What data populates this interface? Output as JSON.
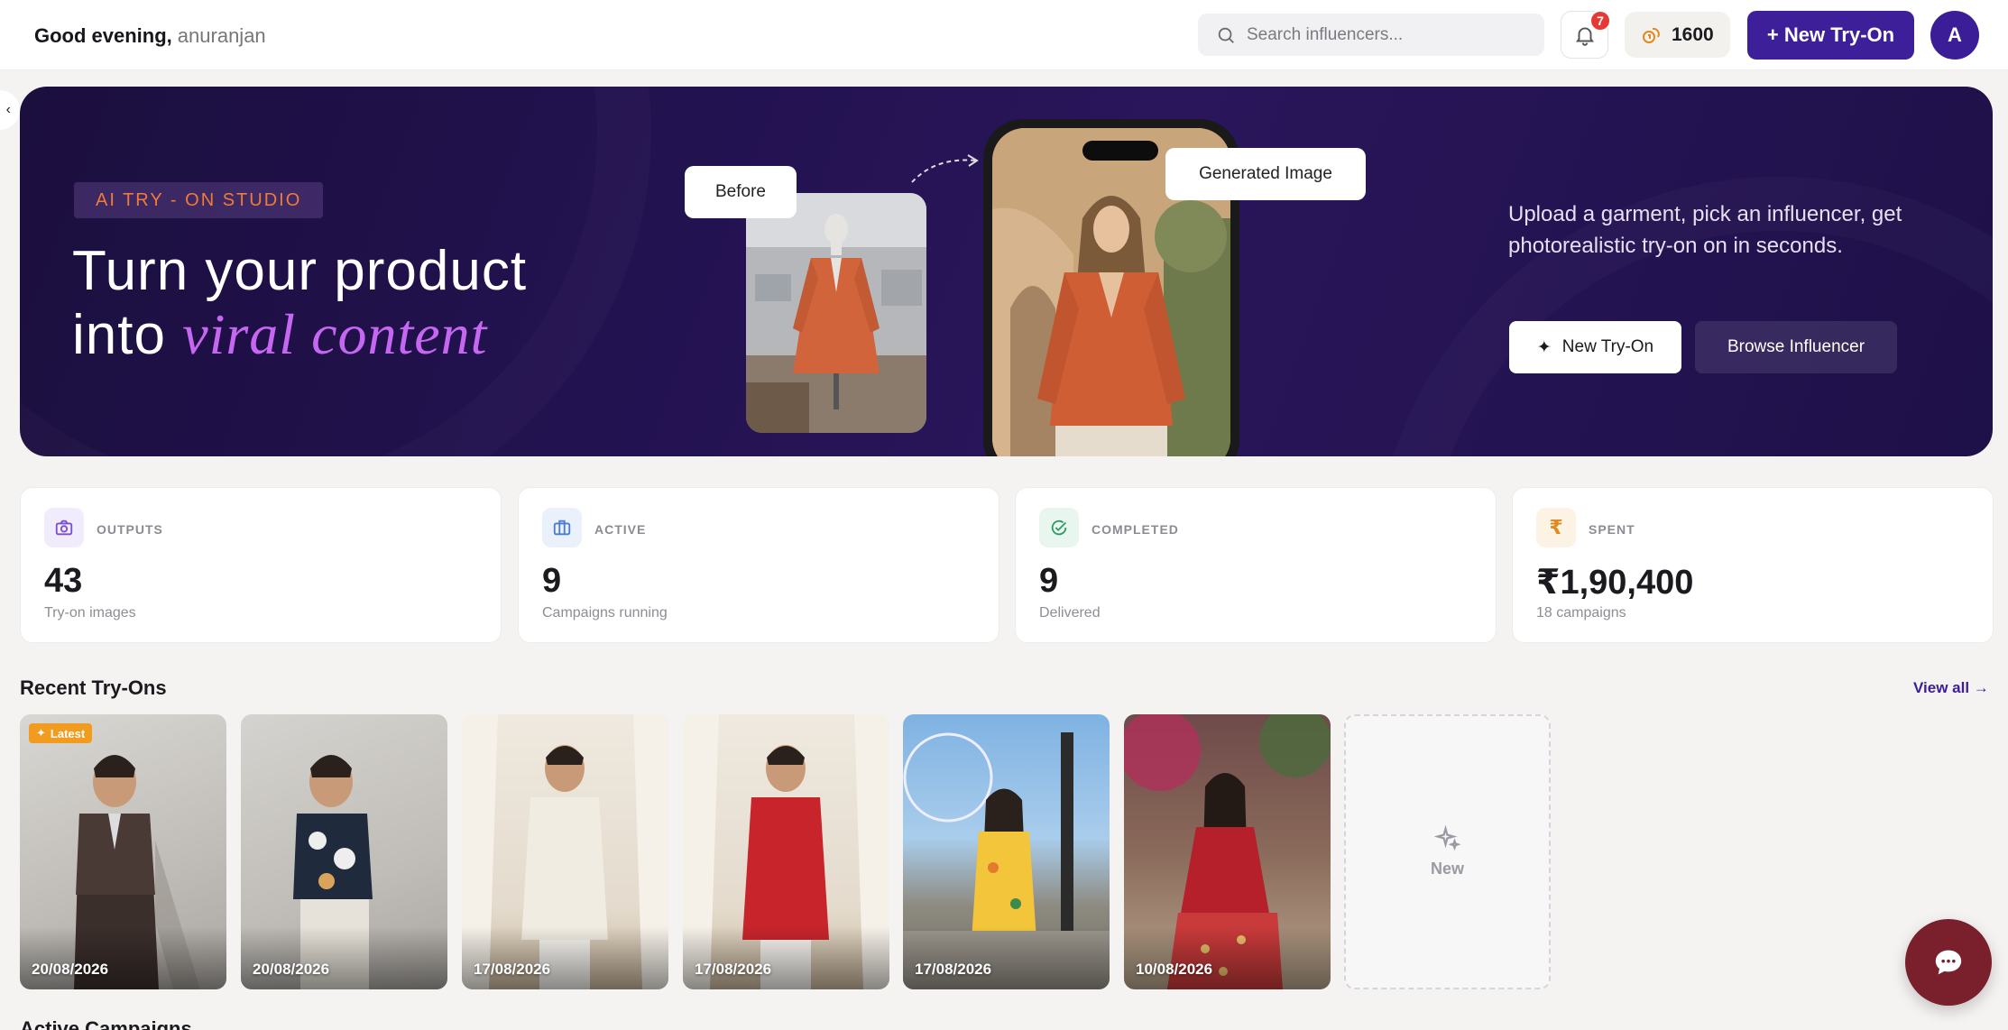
{
  "header": {
    "greeting": "Good evening,",
    "username": "anuranjan",
    "search_placeholder": "Search influencers...",
    "notification_count": "7",
    "credits": "1600",
    "new_tryon_label": "+ New Try-On",
    "avatar_initial": "A"
  },
  "hero": {
    "tag": "AI TRY - ON STUDIO",
    "title_line1": "Turn your product",
    "title_line2_prefix": "into",
    "title_line2_emphasis": "viral content",
    "before_label": "Before",
    "generated_label": "Generated Image",
    "description": "Upload a garment, pick an influencer, get photorealistic try-on on in seconds.",
    "primary_button": "New Try-On",
    "secondary_button": "Browse Influencer"
  },
  "stats": [
    {
      "label": "OUTPUTS",
      "value": "43",
      "sub": "Try-on images",
      "icon": "camera-icon",
      "color": "#7b4fd1"
    },
    {
      "label": "ACTIVE",
      "value": "9",
      "sub": "Campaigns running",
      "icon": "briefcase-icon",
      "color": "#4a7bd6"
    },
    {
      "label": "COMPLETED",
      "value": "9",
      "sub": "Delivered",
      "icon": "check-circle-icon",
      "color": "#2e9b63"
    },
    {
      "label": "SPENT",
      "value": "₹1,90,400",
      "sub": "18 campaigns",
      "icon": "rupee-icon",
      "color": "#e08a1f"
    }
  ],
  "recent": {
    "title": "Recent Try-Ons",
    "view_all": "View all →",
    "latest_badge": "Latest",
    "new_label": "New",
    "items": [
      {
        "date": "20/08/2026"
      },
      {
        "date": "20/08/2026"
      },
      {
        "date": "17/08/2026"
      },
      {
        "date": "17/08/2026"
      },
      {
        "date": "17/08/2026"
      },
      {
        "date": "10/08/2026"
      }
    ]
  },
  "next_section_title": "Active Campaigns"
}
